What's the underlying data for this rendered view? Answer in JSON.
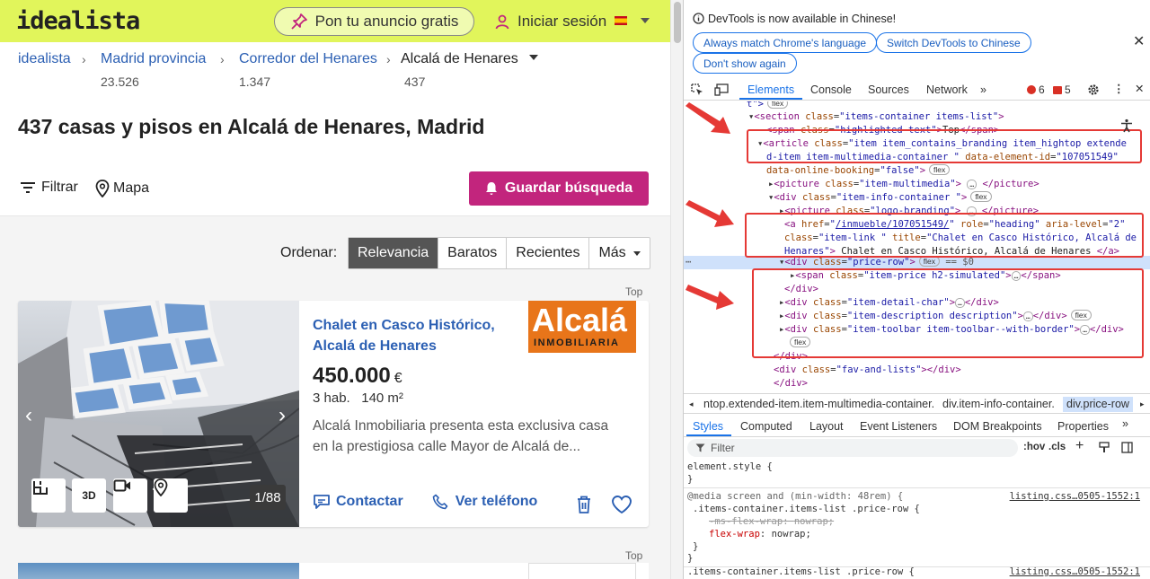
{
  "site": {
    "logo": "idealista",
    "publish_label": "Pon tu anuncio gratis",
    "login_label": "Iniciar sesión"
  },
  "breadcrumb": [
    {
      "label": "idealista",
      "count": ""
    },
    {
      "label": "Madrid provincia",
      "count": "23.526"
    },
    {
      "label": "Corredor del Henares",
      "count": "1.347"
    },
    {
      "label": "Alcalá de Henares",
      "count": "437"
    }
  ],
  "page_title": "437 casas y pisos en Alcalá de Henares, Madrid",
  "toolbar": {
    "filter_label": "Filtrar",
    "map_label": "Mapa",
    "save_search_label": "Guardar búsqueda"
  },
  "sort": {
    "label": "Ordenar:",
    "options": [
      "Relevancia",
      "Baratos",
      "Recientes",
      "Más"
    ]
  },
  "listing": {
    "top_label": "Top",
    "title": "Chalet en Casco Histórico, Alcalá de Henares",
    "price": "450.000",
    "currency": "€",
    "rooms": "3 hab.",
    "area": "140 m²",
    "description": "Alcalá Inmobiliaria presenta esta exclusiva casa en la prestigiosa calle Mayor de Alcalá de...",
    "photo_count": "1/88",
    "brand_line1": "Alcalá",
    "brand_line2": "INMOBILIARIA",
    "contact_label": "Contactar",
    "phone_label": "Ver teléfono"
  },
  "listing2": {
    "top_label": "Top"
  },
  "devtools": {
    "banner_message": "DevTools is now available in Chinese!",
    "banner_buttons": [
      "Always match Chrome's language",
      "Switch DevTools to Chinese",
      "Don't show again"
    ],
    "tabs": [
      "Elements",
      "Console",
      "Sources",
      "Network"
    ],
    "error_count": "6",
    "warning_count": "5",
    "dom_lines": {
      "l0_text": "t\">",
      "section_class": "items-container items-list",
      "span_class": "highlighted-text",
      "span_text": "Top",
      "article_class_1": "item   item_contains_branding item_hightop extende",
      "article_class_2": "d-item item-multimedia-container ",
      "article_id": "107051549",
      "booking_val": "false",
      "picture_class": "item-multimedia",
      "info_class": "item-info-container ",
      "logo_class": "logo-branding",
      "a_href": "/inmueble/107051549/",
      "a_role": "heading",
      "a_level": "2",
      "a_class": "item-link ",
      "a_title_1": "Chalet en Casco Histórico, Alcalá de",
      "a_title_2": "Henares",
      "a_text": " Chalet en Casco Histórico, Alcalá de Henares ",
      "price_row_class": "price-row",
      "eq_ref": "== $0",
      "price_span_class": "item-price h2-simulated",
      "detail_class": "item-detail-char",
      "desc_class": "item-description description",
      "toolbar_class": "item-toolbar item-toolbar--with-border",
      "fav_class": "fav-and-lists"
    },
    "crumbs": [
      "ntop.extended-item.item-multimedia-container.",
      "div.item-info-container.",
      "div.price-row"
    ],
    "sub_tabs": [
      "Styles",
      "Computed",
      "Layout",
      "Event Listeners",
      "DOM Breakpoints",
      "Properties"
    ],
    "filter_placeholder": "Filter",
    "hov": ":hov",
    "cls": ".cls",
    "styles": {
      "element_style": "element.style {",
      "close": "}",
      "media": "@media screen and (min-width: 48rem) {",
      "rule1": ".items-container.items-list .price-row {",
      "p1_name": "-ms-flex-wrap",
      "p1_val": "nowrap;",
      "p2_name": "flex-wrap",
      "p2_val": "nowrap;",
      "rule2": ".items-container.items-list .price-row {",
      "source": "listing.css…0505-1552:1"
    },
    "flex_badge": "flex"
  }
}
